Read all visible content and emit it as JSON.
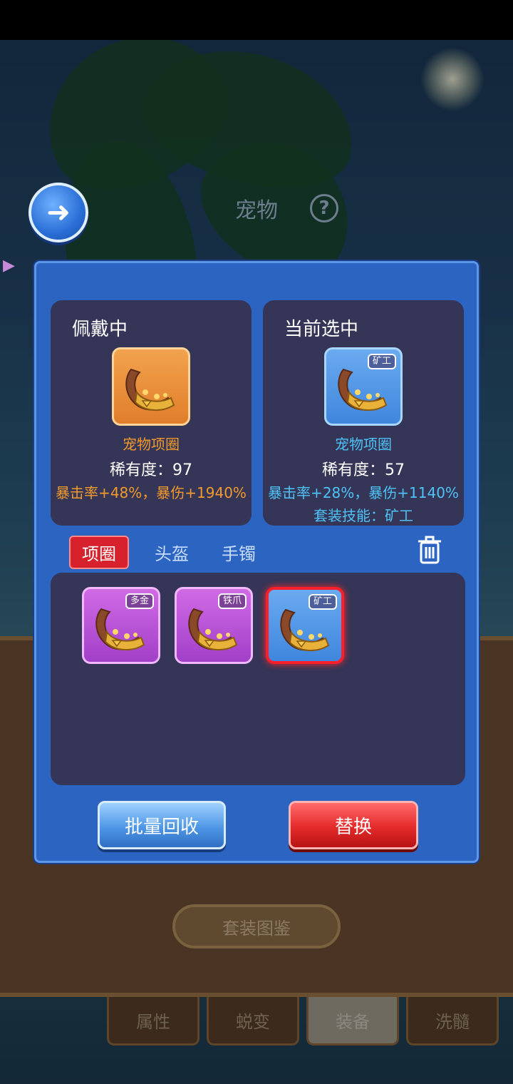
{
  "header": {
    "title": "宠物",
    "help_icon": "question-mark-icon",
    "back_icon": "back-arrow-icon"
  },
  "equipped": {
    "heading": "佩戴中",
    "item_name": "宠物项圈",
    "rarity": "稀有度：97",
    "stats": "暴击率+48%，暴伤+1940%",
    "frame_color": "#f08c3a",
    "name_color": "#f39a2c"
  },
  "selected": {
    "heading": "当前选中",
    "tag": "矿工",
    "item_name": "宠物项圈",
    "rarity": "稀有度：57",
    "stats": "暴击率+28%，暴伤+1140%",
    "skill": "套装技能：矿工",
    "frame_color": "#4f96e6",
    "name_color": "#4fc3f7"
  },
  "tabs": {
    "items": [
      "项圈",
      "头盔",
      "手镯"
    ],
    "active": "项圈"
  },
  "inventory": {
    "slots": [
      {
        "tag": "多金",
        "rarity_color": "purple"
      },
      {
        "tag": "铁爪",
        "rarity_color": "purple"
      },
      {
        "tag": "矿工",
        "rarity_color": "blue",
        "selected": true
      }
    ]
  },
  "buttons": {
    "recycle": "批量回收",
    "replace": "替换"
  },
  "background": {
    "suit_button": "套装图鉴",
    "bottom_tabs": [
      "属性",
      "蜕变",
      "装备",
      "洗髓"
    ],
    "active_bottom_tab": "装备"
  }
}
